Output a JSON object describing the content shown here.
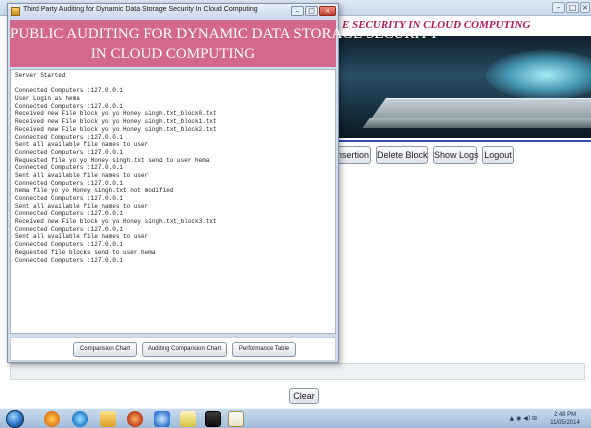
{
  "background_app": {
    "header_title": "E SECURITY IN CLOUD COMPUTING",
    "toolbar": [
      "nsertion",
      "Delete Block",
      "Show Logs",
      "Logout"
    ],
    "clear_label": "Clear"
  },
  "dialog": {
    "title": "Third Party Auditing for Dynamic Data Storage Security In Cloud Computing",
    "heading_line1": "PUBLIC AUDITING FOR DYNAMIC DATA STORAGE SECURITY",
    "heading_line2": "IN CLOUD COMPUTING",
    "log_lines": [
      "Server Started",
      "",
      "Connected Computers :127.0.0.1",
      "User Login as hema",
      "Connected Computers :127.0.0.1",
      "Received new File block yo yo Honey singh.txt_block0.txt",
      "Received new File block yo yo Honey singh.txt_block1.txt",
      "Received new File block yo yo Honey singh.txt_block2.txt",
      "Connected Computers :127.0.0.1",
      "Sent all available file names to user",
      "Connected Computers :127.0.0.1",
      "Requested file yo yo Honey singh.txt send to user hema",
      "Connected Computers :127.0.0.1",
      "Sent all available file names to user",
      "Connected Computers :127.0.0.1",
      "hema file yo yo Honey singh.txt not modified",
      "Connected Computers :127.0.0.1",
      "Sent all available file names to user",
      "Connected Computers :127.0.0.1",
      "Received new File block yo yo Honey singh.txt_block3.txt",
      "Connected Computers :127.0.0.1",
      "Sent all available file names to user",
      "Connected Computers :127.0.0.1",
      "Requested file blocks send to user hema",
      "Connected Computers :127.0.0.1"
    ],
    "buttons": {
      "comparision_chart": "Comparision Chart",
      "auditing_comparision_chart": "Auditing Comparision Chart",
      "performance_table": "Performance Table"
    }
  },
  "taskbar": {
    "time": "2:48 PM",
    "date": "11/05/2014"
  },
  "colors": {
    "heading_bg": "#d3688c",
    "header_title": "#b3195b",
    "divider": "#3a4bb8"
  }
}
